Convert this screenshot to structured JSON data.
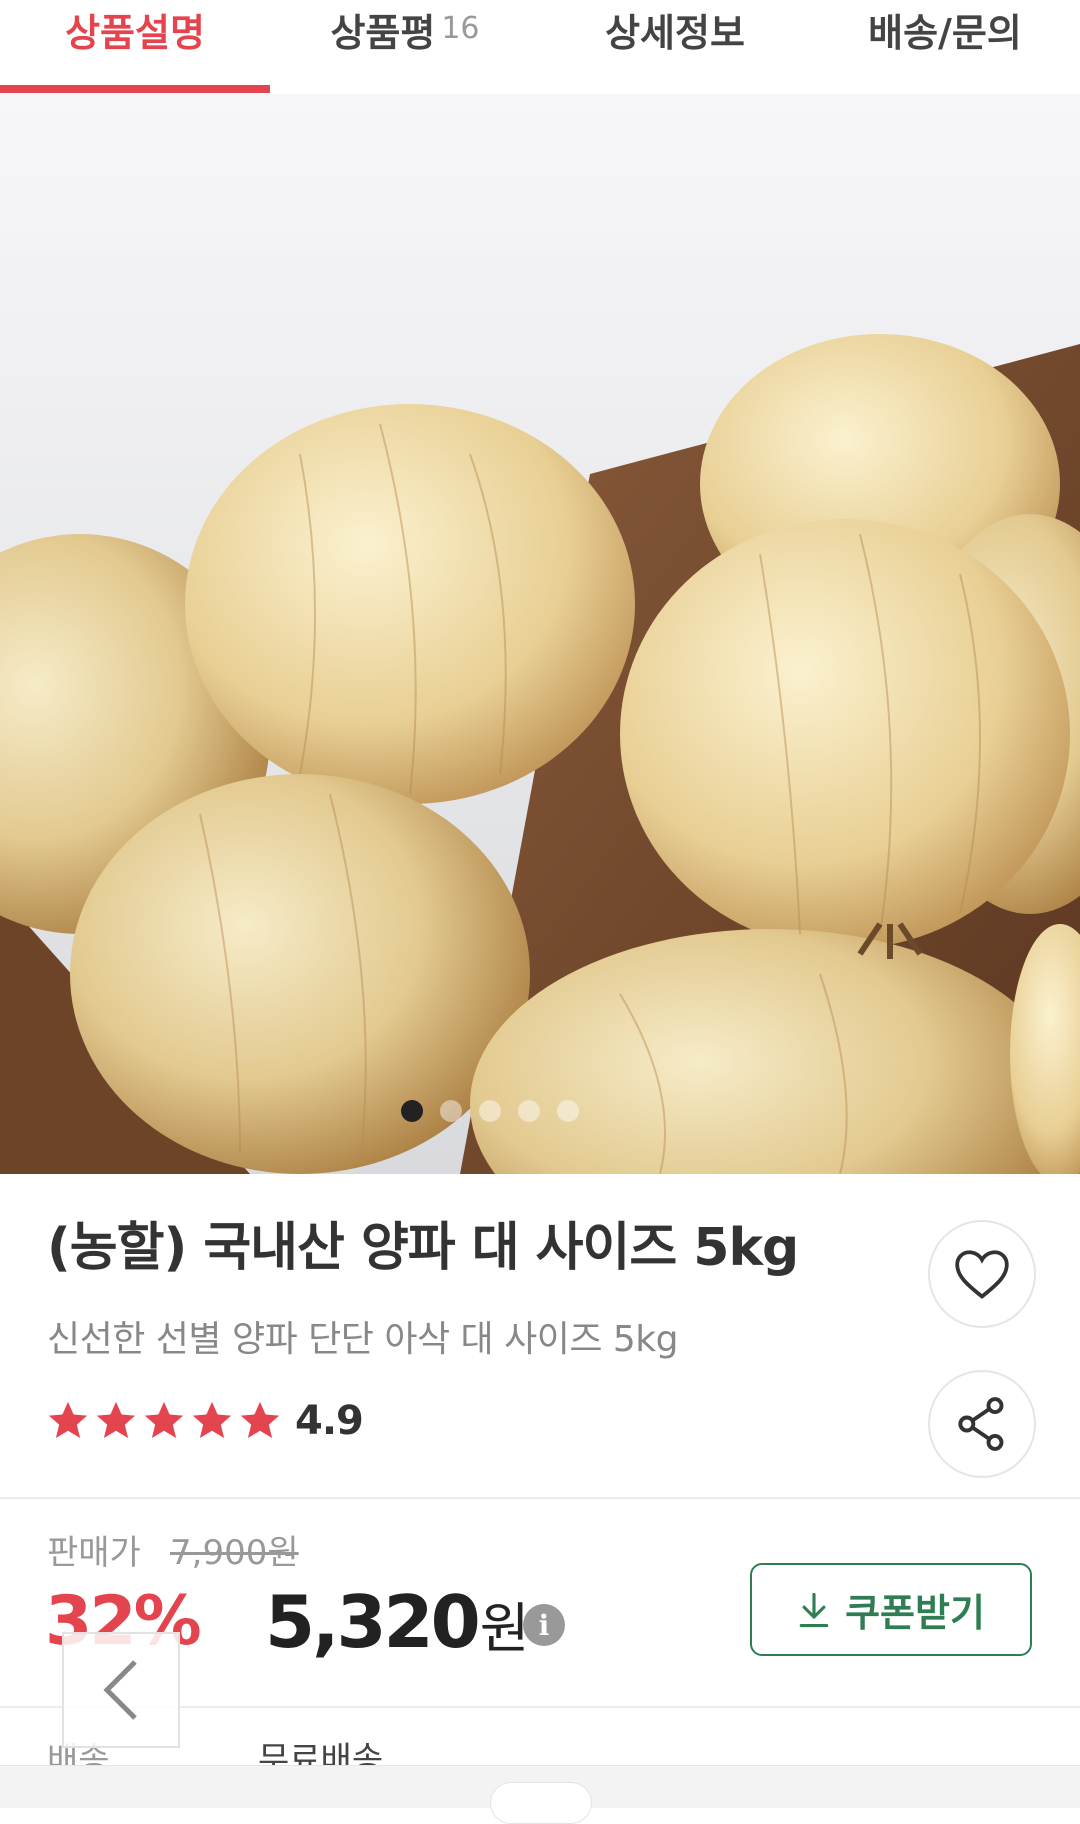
{
  "tabs": [
    {
      "label": "상품설명",
      "count": ""
    },
    {
      "label": "상품평",
      "count": "16"
    },
    {
      "label": "상세정보",
      "count": ""
    },
    {
      "label": "배송/문의",
      "count": ""
    }
  ],
  "active_tab_index": 0,
  "hero": {
    "image_subject": "onions-in-wooden-crate",
    "slide_count": 5,
    "active_slide": 0
  },
  "product": {
    "title": "(농할) 국내산 양파 대 사이즈 5kg",
    "subtitle": "신선한 선별 양파 단단 아삭 대 사이즈 5kg",
    "rating": "4.9",
    "rating_stars": 5
  },
  "price": {
    "label": "판매가",
    "original": "7,900원",
    "discount": "32%",
    "sale_amount": "5,320",
    "sale_unit": "원",
    "info_icon": "i"
  },
  "coupon": {
    "label": "쿠폰받기",
    "icon": "download-icon"
  },
  "shipping": {
    "label": "배송",
    "value": "무료배송"
  },
  "colors": {
    "accent": "#e4444e",
    "coupon": "#2f7d52",
    "text": "#333333",
    "muted": "#999999"
  }
}
